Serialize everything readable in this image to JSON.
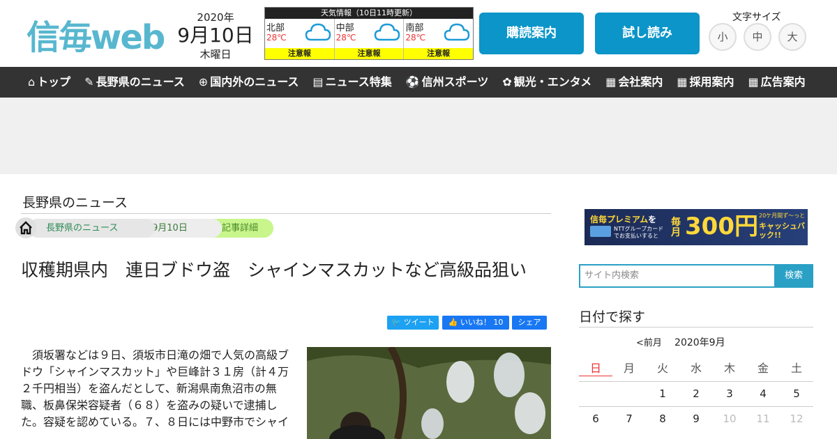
{
  "logo": "信毎web",
  "date": {
    "year": "2020年",
    "month_day": "9月10日",
    "weekday": "木曜日"
  },
  "weather": {
    "header": "天気情報（10日11時更新）",
    "regions": [
      {
        "name": "北部",
        "temp": "28℃",
        "alert": "注意報",
        "icon": "cloud-icon"
      },
      {
        "name": "中部",
        "temp": "28℃",
        "alert": "注意報",
        "icon": "cloud-icon"
      },
      {
        "name": "南部",
        "temp": "28℃",
        "alert": "注意報",
        "icon": "cloud-icon"
      }
    ]
  },
  "header_buttons": {
    "subscribe": "購読案内",
    "trial": "試し読み"
  },
  "font_size": {
    "label": "文字サイズ",
    "small": "小",
    "medium": "中",
    "large": "大"
  },
  "nav": [
    {
      "icon": "⌂",
      "label": "トップ"
    },
    {
      "icon": "✎",
      "label": "長野県のニュース"
    },
    {
      "icon": "⊕",
      "label": "国内外のニュース"
    },
    {
      "icon": "▤",
      "label": "ニュース特集"
    },
    {
      "icon": "⚽",
      "label": "信州スポーツ"
    },
    {
      "icon": "✿",
      "label": "観光・エンタメ"
    },
    {
      "icon": "▦",
      "label": "会社案内"
    },
    {
      "icon": "▦",
      "label": "採用案内"
    },
    {
      "icon": "▦",
      "label": "広告案内"
    }
  ],
  "section_title": "長野県のニュース",
  "breadcrumbs": [
    "長野県のニュース",
    "9月10日",
    "記事詳細"
  ],
  "article": {
    "title": "収穫期県内　連日ブドウ盗　シャインマスカットなど高級品狙い",
    "body": "　須坂署などは９日、須坂市日滝の畑で人気の高級ブドウ「シャインマスカット」や巨峰計３１房（計４万２千円相当）を盗んだとして、新潟県南魚沼市の無職、板鼻保栄容疑者（６８）を盗みの疑いで逮捕した。容疑を認めている。７、８日には中野市でシャイ"
  },
  "share": {
    "tweet": "ツイート",
    "like": "いいね！",
    "like_count": "10",
    "share": "シェア"
  },
  "banner": {
    "brand": "信毎プレミアム",
    "suffix": "を",
    "sub": "NTTグループカードでお支払いすると",
    "monthly": "毎月",
    "amount": "300円",
    "cashback": "キャッシュバック!!",
    "period": "20ケ月間ず〜っと"
  },
  "search": {
    "placeholder": "サイト内検索",
    "button": "検索"
  },
  "calendar": {
    "title": "日付で探す",
    "prev": "<前月",
    "current": "2020年9月",
    "weekdays": [
      "日",
      "月",
      "火",
      "水",
      "木",
      "金",
      "土"
    ],
    "rows": [
      [
        "",
        "",
        "1",
        "2",
        "3",
        "4",
        "5"
      ],
      [
        "6",
        "7",
        "8",
        "9",
        "10",
        "11",
        "12"
      ]
    ]
  }
}
